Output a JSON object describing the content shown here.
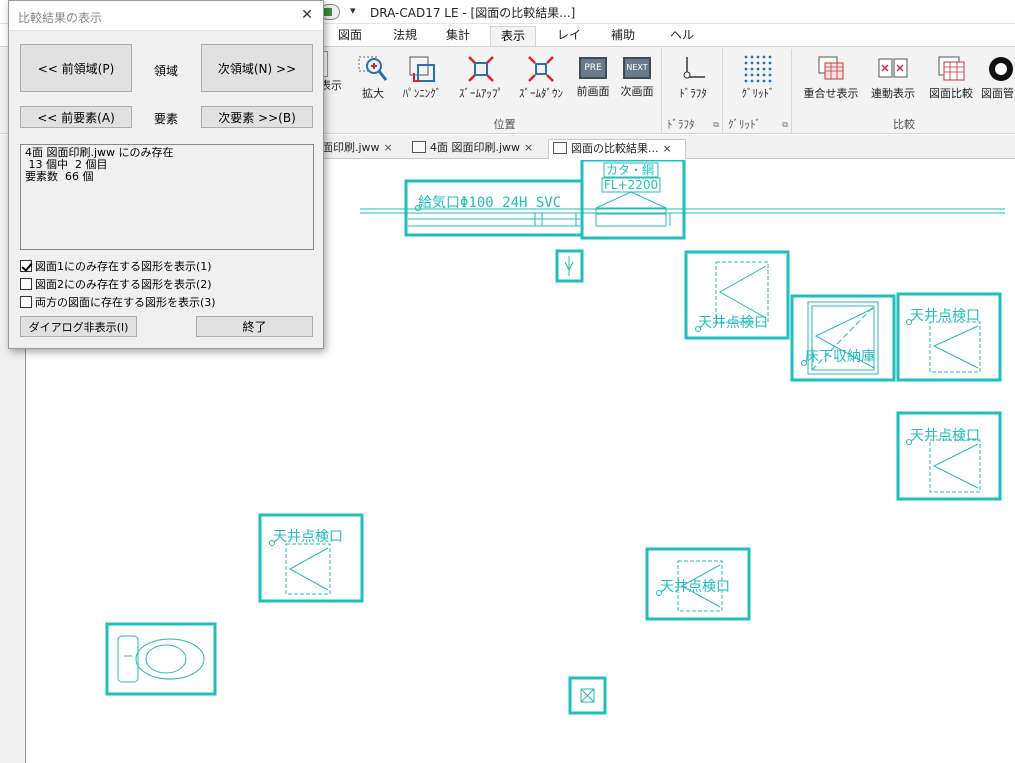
{
  "window": {
    "title": "DRA-CAD17 LE - [図面の比較結果...]",
    "qat_dropdown": "▾"
  },
  "ribbon_tabs": [
    {
      "label": "図面"
    },
    {
      "label": "法規"
    },
    {
      "label": "集計"
    },
    {
      "label": "表示",
      "active": true
    },
    {
      "label": "レイヤ"
    },
    {
      "label": "補助"
    },
    {
      "label": "ヘルプ"
    }
  ],
  "ribbon": {
    "partial_label": "表示",
    "position_group": {
      "label": "位置",
      "buttons": [
        {
          "label": "拡大",
          "icon": "magnify-plus-icon"
        },
        {
          "label": "ﾊﾟﾝﾆﾝｸﾞ",
          "icon": "panning-icon"
        },
        {
          "label": "ｽﾞｰﾑｱｯﾌﾟ",
          "icon": "zoom-up-icon"
        },
        {
          "label": "ｽﾞｰﾑﾀﾞｳﾝ",
          "icon": "zoom-down-icon"
        },
        {
          "label": "前画面",
          "icon": "pre-screen-icon",
          "icon_text": "PRE"
        },
        {
          "label": "次画面",
          "icon": "next-screen-icon",
          "icon_text": "NEXT"
        }
      ]
    },
    "drafter_group": {
      "label": "ﾄﾞﾗﾌﾀ",
      "button": {
        "label": "ﾄﾞﾗﾌﾀ",
        "icon": "drafter-icon"
      }
    },
    "grid_group": {
      "label": "ｸﾞﾘｯﾄﾞ",
      "button": {
        "label": "ｸﾞﾘｯﾄﾞ",
        "icon": "grid-icon"
      }
    },
    "compare_group": {
      "label": "比較",
      "buttons": [
        {
          "label": "重合せ表示",
          "icon": "overlay-icon"
        },
        {
          "label": "連動表示",
          "icon": "linked-view-icon"
        },
        {
          "label": "図面比較",
          "icon": "drawing-compare-icon"
        },
        {
          "label": "図面管",
          "icon": "drawing-manage-icon"
        }
      ]
    },
    "launcher_glyph": "⧉"
  },
  "doc_tabs": [
    {
      "label": "面印刷.jww",
      "close": "×"
    },
    {
      "label": "4面 図面印刷.jww",
      "close": "×"
    },
    {
      "label": "図面の比較結果...",
      "close": "×",
      "active": true
    }
  ],
  "dialog": {
    "title": "比較結果の表示",
    "close": "✕",
    "prev_area": "<< 前領域(P)",
    "area_label": "領域",
    "next_area": "次領域(N) >>",
    "prev_elem": "<< 前要素(A)",
    "elem_label": "要素",
    "next_elem": "次要素 >>(B)",
    "message_lines": [
      "4面 図面印刷.jww にのみ存在",
      " 13 個中  2 個目",
      "要素数  66 個"
    ],
    "checkboxes": [
      {
        "label": "図面1にのみ存在する図形を表示(1)",
        "checked": true
      },
      {
        "label": "図面2にのみ存在する図形を表示(2)",
        "checked": false
      },
      {
        "label": "両方の図面に存在する図形を表示(3)",
        "checked": false
      }
    ],
    "hide_button": "ダイアログ非表示(I)",
    "end_button": "終了"
  },
  "drawing": {
    "highlight_color": "#1fbfbf",
    "vent_label": "給気口Φ100 24H SVC",
    "window_label_1": "カタ・網",
    "window_label_2": "FL+2200",
    "ceiling_hatch": "天井点検口",
    "floor_storage": "床下収納庫"
  }
}
